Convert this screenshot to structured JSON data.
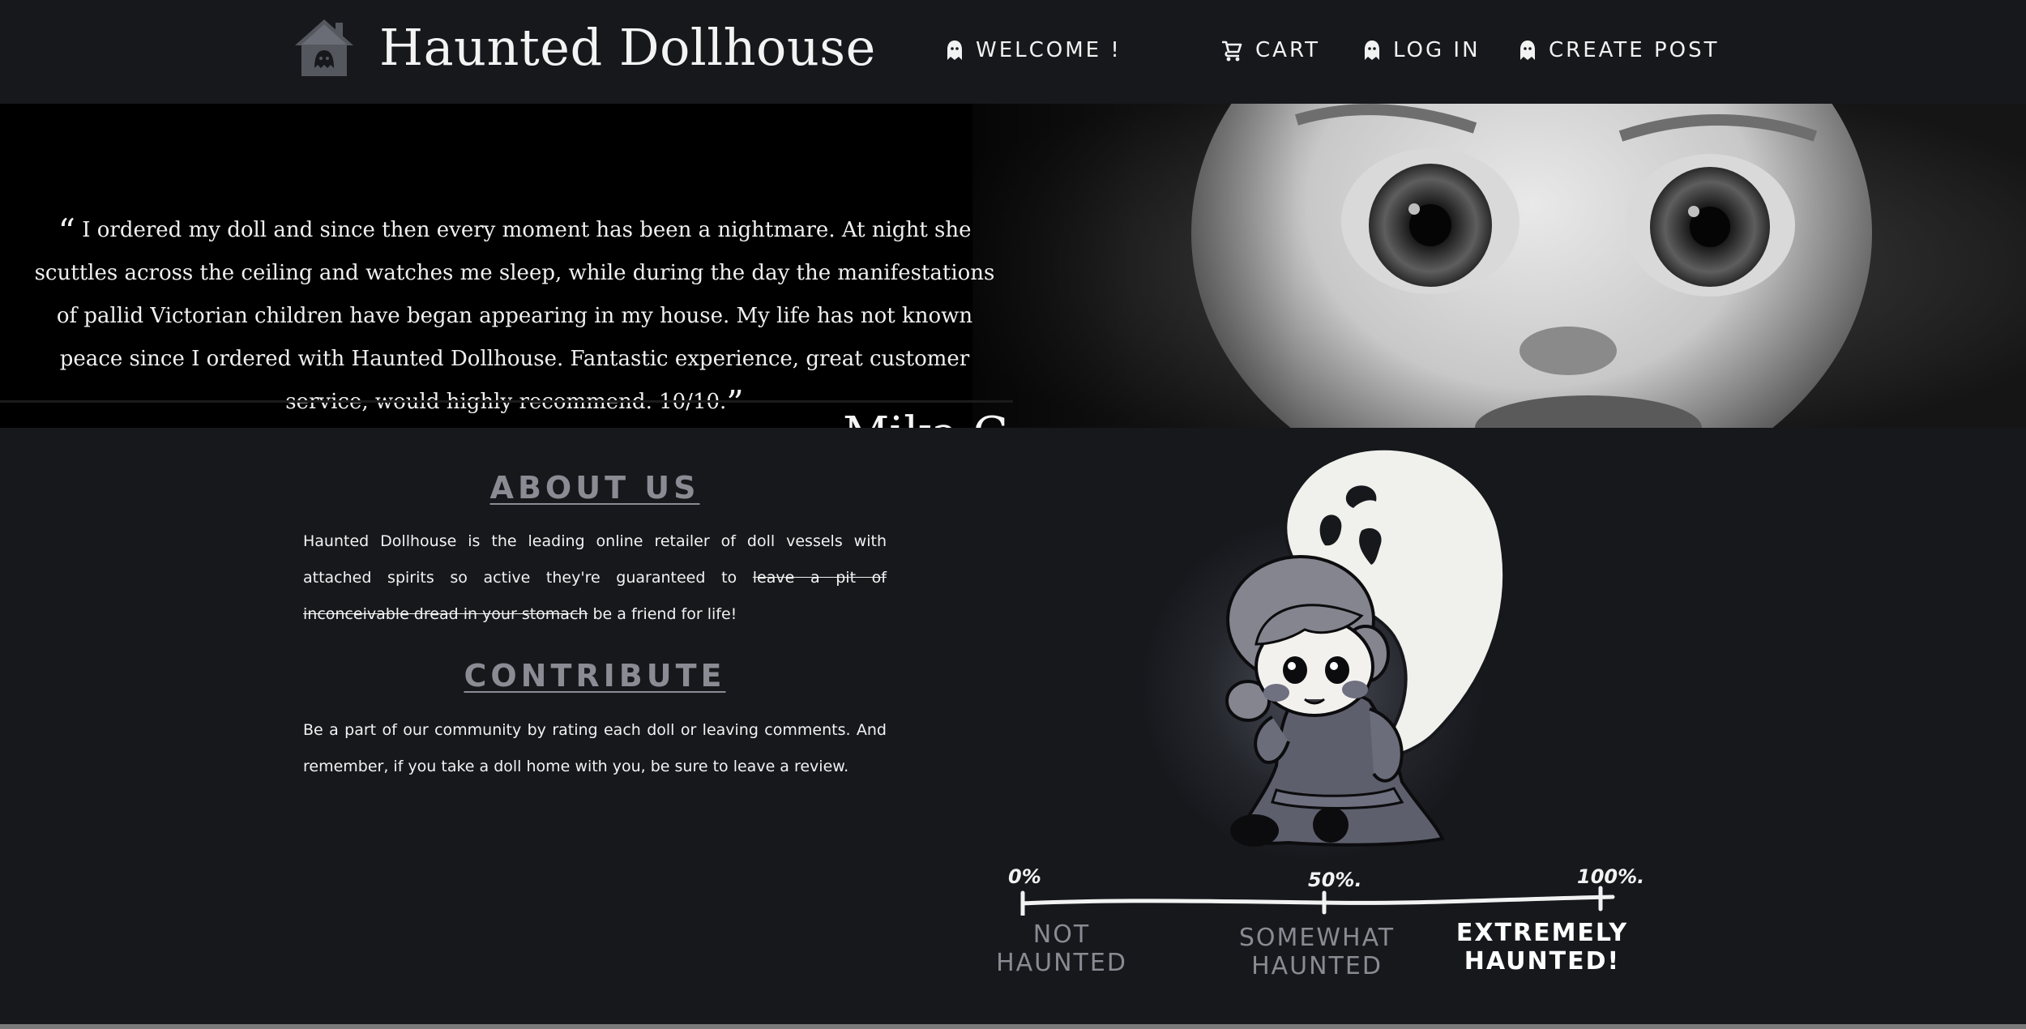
{
  "header": {
    "title": "Haunted Dollhouse",
    "logo_icon": "haunted-house-icon",
    "nav": {
      "welcome": "WELCOME !",
      "cart": "CART",
      "login": "LOG IN",
      "create_post": "CREATE POST"
    },
    "nav_icons": [
      "ghost-icon",
      "stroller-cart-icon",
      "ghost-icon",
      "ghost-icon"
    ]
  },
  "hero": {
    "quote_open": "“",
    "quote": "I ordered my doll and since then every moment has been a nightmare. At night she scuttles across the ceiling and watches me sleep, while during the day the manifestations of pallid Victorian children have began appearing in my house. My life has not known peace since I ordered with Haunted Dollhouse. Fantastic experience, great customer service, would highly recommend. 10/10.",
    "quote_close": "”",
    "author": "Mika G"
  },
  "about": {
    "heading": "ABOUT US",
    "text_before": "Haunted Dollhouse is the leading online retailer of doll vessels with attached spirits so active they're guaranteed to ",
    "text_struck": "leave a pit of inconceivable dread in your stomach",
    "text_after": " be a friend for life!"
  },
  "contribute": {
    "heading": "CONTRIBUTE",
    "text": "Be a part of our community by rating each doll or leaving comments. And remember, if you take a doll home with you, be sure to leave a review."
  },
  "scale": {
    "marks": [
      "0%",
      "50%.",
      "100%."
    ],
    "labels": [
      "NOT\nHAUNTED",
      "SOMEWHAT\nHAUNTED",
      "EXTREMELY\nHAUNTED!"
    ]
  },
  "colors": {
    "background": "#16181c",
    "heading": "#8b8b94",
    "text": "#f2f2f2"
  }
}
